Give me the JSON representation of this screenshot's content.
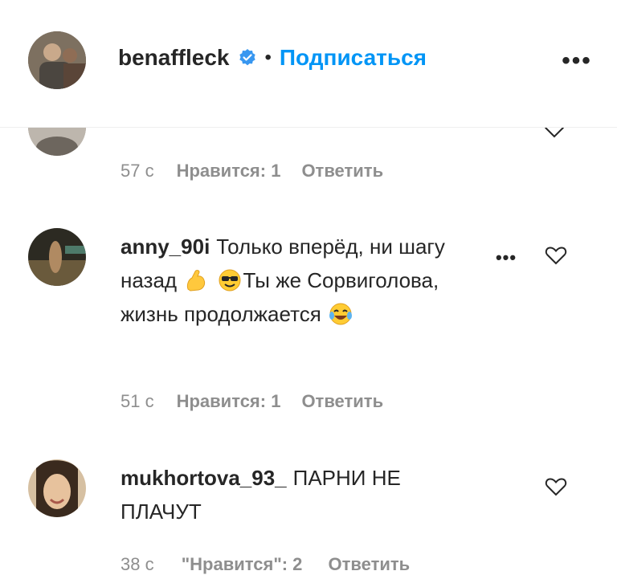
{
  "header": {
    "username": "benaffleck",
    "separator": "•",
    "follow_label": "Подписаться",
    "more_label": "•••"
  },
  "comments": [
    {
      "time": "57 с",
      "likes": "Нравится: 1",
      "reply": "Ответить"
    },
    {
      "username": "anny_90i",
      "text_1": "Только вперёд, ни шагу назад",
      "text_2": "Ты же Сорвиголова, жизнь продолжается",
      "more_label": "•••",
      "time": "51 с",
      "likes": "Нравится: 1",
      "reply": "Ответить"
    },
    {
      "username": "mukhortova_93_",
      "text": "ПАРНИ НЕ ПЛАЧУТ",
      "time": "38 с",
      "likes": "\"Нравится\": 2",
      "reply": "Ответить"
    }
  ],
  "colors": {
    "link": "#0095f6",
    "muted": "#8e8e8e",
    "text": "#262626",
    "verified": "#3897f0"
  }
}
